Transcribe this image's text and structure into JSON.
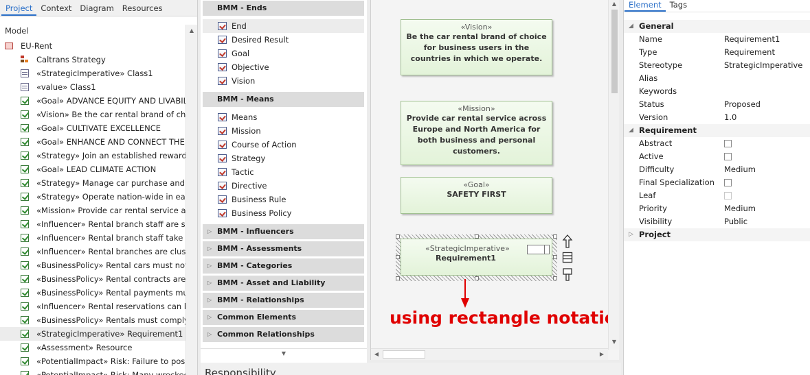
{
  "project_panel": {
    "tabs": [
      "Project",
      "Context",
      "Diagram",
      "Resources"
    ],
    "heading": "Model",
    "items": [
      {
        "label": "EU-Rent",
        "icon": "package-icon",
        "level": 0
      },
      {
        "label": "Caltrans Strategy",
        "icon": "diagram-tree-icon",
        "level": 1
      },
      {
        "label": "«StrategicImperative» Class1",
        "icon": "class-icon",
        "level": 1
      },
      {
        "label": "«value» Class1",
        "icon": "class-icon",
        "level": 1
      },
      {
        "label": "«Goal» ADVANCE EQUITY AND LIVABILITY",
        "icon": "requirement-icon",
        "level": 1
      },
      {
        "label": "«Vision» Be the car rental brand of choice",
        "icon": "requirement-icon",
        "level": 1
      },
      {
        "label": "«Goal» CULTIVATE EXCELLENCE",
        "icon": "requirement-icon",
        "level": 1
      },
      {
        "label": "«Goal» ENHANCE AND CONNECT THE M",
        "icon": "requirement-icon",
        "level": 1
      },
      {
        "label": "«Strategy» Join an established rewards sc",
        "icon": "requirement-icon",
        "level": 1
      },
      {
        "label": "«Goal» LEAD CLIMATE ACTION",
        "icon": "requirement-icon",
        "level": 1
      },
      {
        "label": "«Strategy» Manage car purchase and disp",
        "icon": "requirement-icon",
        "level": 1
      },
      {
        "label": "«Strategy» Operate nation-wide in each c",
        "icon": "requirement-icon",
        "level": 1
      },
      {
        "label": "«Mission» Provide car rental service acros",
        "icon": "requirement-icon",
        "level": 1
      },
      {
        "label": "«Influencer» Rental branch staff are supp",
        "icon": "requirement-icon",
        "level": 1
      },
      {
        "label": "«Influencer» Rental branch staff take goo",
        "icon": "requirement-icon",
        "level": 1
      },
      {
        "label": "«Influencer» Rental branches are clustere",
        "icon": "requirement-icon",
        "level": 1
      },
      {
        "label": "«BusinessPolicy» Rental cars must not be",
        "icon": "requirement-icon",
        "level": 1
      },
      {
        "label": "«BusinessPolicy» Rental contracts are ma",
        "icon": "requirement-icon",
        "level": 1
      },
      {
        "label": "«BusinessPolicy» Rental payments must b",
        "icon": "requirement-icon",
        "level": 1
      },
      {
        "label": "«Influencer» Rental reservations can be m",
        "icon": "requirement-icon",
        "level": 1
      },
      {
        "label": "«BusinessPolicy» Rentals must comply w",
        "icon": "requirement-icon",
        "level": 1
      },
      {
        "label": "«StrategicImperative» Requirement1",
        "icon": "requirement-icon",
        "level": 1,
        "selected": true
      },
      {
        "label": "«Assessment» Resource",
        "icon": "requirement-icon",
        "level": 1
      },
      {
        "label": "«PotentialImpact» Risk: Failure to position",
        "icon": "requirement-icon",
        "level": 1
      },
      {
        "label": "«PotentialImpact» Risk: Many wrecked c",
        "icon": "requirement-icon",
        "level": 1
      }
    ]
  },
  "toolbox": {
    "groups": [
      {
        "label": "BMM - Ends",
        "expanded": true,
        "items": [
          "End",
          "Desired Result",
          "Goal",
          "Objective",
          "Vision"
        ]
      },
      {
        "label": "BMM - Means",
        "expanded": true,
        "items": [
          "Means",
          "Mission",
          "Course of Action",
          "Strategy",
          "Tactic",
          "Directive",
          "Business Rule",
          "Business Policy"
        ]
      },
      {
        "label": "BMM - Influencers",
        "expanded": false
      },
      {
        "label": "BMM - Assessments",
        "expanded": false
      },
      {
        "label": "BMM - Categories",
        "expanded": false
      },
      {
        "label": "BMM - Asset and Liability",
        "expanded": false
      },
      {
        "label": "BMM - Relationships",
        "expanded": false
      },
      {
        "label": "Common Elements",
        "expanded": false
      },
      {
        "label": "Common Relationships",
        "expanded": false
      }
    ],
    "bottom_panel_title": "Responsibility"
  },
  "diagram": {
    "elements": [
      {
        "stereotype": "«Vision»",
        "name": "Be the car rental brand of choice for business users in the countries in which we operate."
      },
      {
        "stereotype": "«Mission»",
        "name": "Provide car rental service across Europe and North America for both business and personal customers."
      },
      {
        "stereotype": "«Goal»",
        "name": "SAFETY FIRST"
      },
      {
        "stereotype": "«StrategicImperative»",
        "name": "Requirement1",
        "selected": true
      }
    ],
    "annotation": "using rectangle notation",
    "accent_color": "#e00000"
  },
  "properties": {
    "tabs": [
      "Element",
      "Tags"
    ],
    "sections": {
      "general": {
        "label": "General",
        "rows": [
          {
            "key": "Name",
            "value": "Requirement1"
          },
          {
            "key": "Type",
            "value": "Requirement"
          },
          {
            "key": "Stereotype",
            "value": "StrategicImperative"
          },
          {
            "key": "Alias",
            "value": ""
          },
          {
            "key": "Keywords",
            "value": ""
          },
          {
            "key": "Status",
            "value": "Proposed"
          },
          {
            "key": "Version",
            "value": "1.0"
          }
        ]
      },
      "requirement": {
        "label": "Requirement",
        "rows": [
          {
            "key": "Abstract",
            "value": "",
            "checkbox": true
          },
          {
            "key": "Active",
            "value": "",
            "checkbox": true
          },
          {
            "key": "Difficulty",
            "value": "Medium"
          },
          {
            "key": "Final Specialization",
            "value": "",
            "checkbox": true
          },
          {
            "key": "Leaf",
            "value": "",
            "checkbox": true,
            "disabled": true
          },
          {
            "key": "Priority",
            "value": "Medium"
          },
          {
            "key": "Visibility",
            "value": "Public"
          }
        ]
      },
      "project": {
        "label": "Project"
      }
    }
  }
}
